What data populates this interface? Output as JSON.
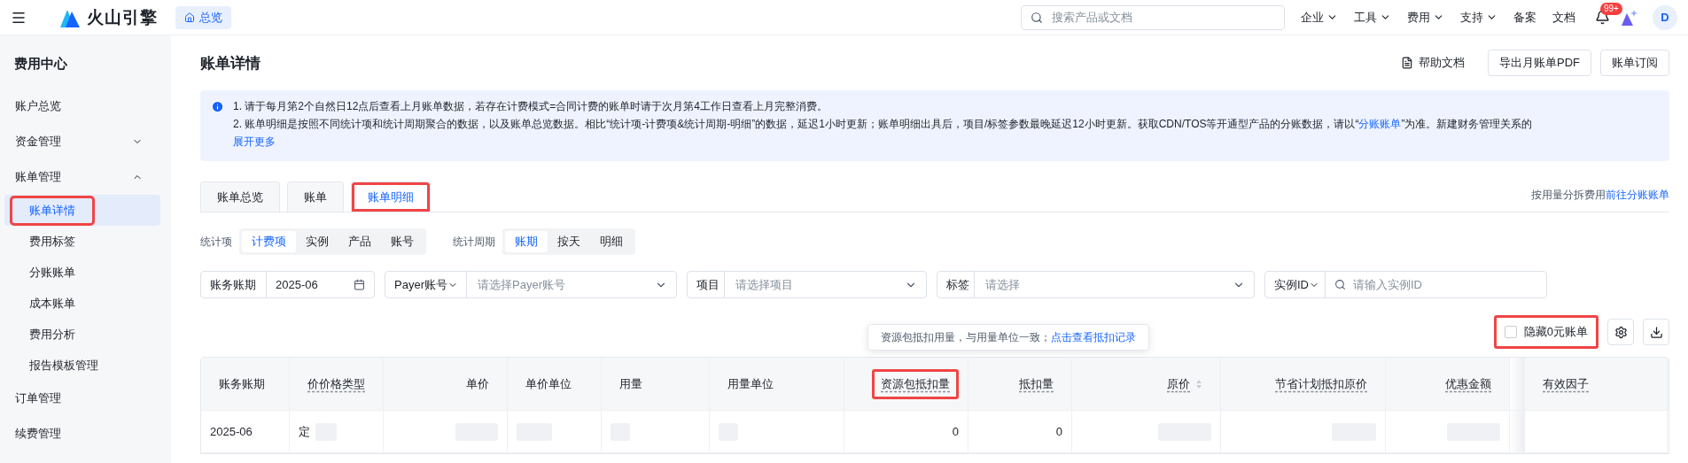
{
  "topbar": {
    "brand": "火山引擎",
    "home_tab": "总览",
    "search": {
      "placeholder": "搜索产品或文档"
    },
    "menus": [
      {
        "label": "企业",
        "dropdown": true
      },
      {
        "label": "工具",
        "dropdown": true
      },
      {
        "label": "费用",
        "dropdown": true
      },
      {
        "label": "支持",
        "dropdown": true
      },
      {
        "label": "备案",
        "dropdown": false
      },
      {
        "label": "文档",
        "dropdown": false
      }
    ],
    "notifications_badge": "99+",
    "avatar": "D"
  },
  "sidebar": {
    "title": "费用中心",
    "items": [
      {
        "label": "账户总览",
        "selected": false
      },
      {
        "label": "资金管理",
        "expanded": false,
        "selected": false
      },
      {
        "label": "账单管理",
        "expanded": true,
        "selected": false,
        "children": [
          {
            "label": "账单详情",
            "selected": true,
            "highlighted": true
          },
          {
            "label": "费用标签",
            "selected": false,
            "highlighted": false
          },
          {
            "label": "分账账单",
            "selected": false,
            "highlighted": false
          },
          {
            "label": "成本账单",
            "selected": false,
            "highlighted": false
          },
          {
            "label": "费用分析",
            "selected": false,
            "highlighted": false
          },
          {
            "label": "报告模板管理",
            "selected": false,
            "highlighted": false
          }
        ]
      },
      {
        "label": "订单管理",
        "selected": false
      },
      {
        "label": "续费管理",
        "selected": false
      }
    ]
  },
  "page": {
    "title": "账单详情",
    "help_link": "帮助文档",
    "buttons": [
      "导出月账单PDF",
      "账单订阅"
    ]
  },
  "notice": {
    "lines": [
      {
        "text": "1. 请于每月第2个自然日12点后查看上月账单数据，若存在计费模式=合同计费的账单时请于次月第4工作日查看上月完整消费。"
      },
      {
        "text": "2. 账单明细是按照不同统计项和统计周期聚合的数据，以及账单总览数据。相比“统计项-计费项&统计周期-明细”的数据，延迟1小时更新；账单明细出具后，项目/标签参数最晚延迟12小时更新。获取CDN/TOS等开通型产品的分账数据，请以“",
        "link": "分账账单",
        "after": "”为准。新建财务管理关系的"
      }
    ],
    "more_link": "展开更多"
  },
  "tabs": [
    {
      "label": "账单总览",
      "selected": false,
      "highlighted": false
    },
    {
      "label": "账单",
      "selected": false,
      "highlighted": false
    },
    {
      "label": "账单明细",
      "selected": true,
      "highlighted": true
    }
  ],
  "split_hint": {
    "text": "按用量分拆费用",
    "link": "前往分账账单"
  },
  "groupings": [
    {
      "label": "统计项",
      "options": [
        {
          "label": "计费项",
          "selected": true
        },
        {
          "label": "实例",
          "selected": false
        },
        {
          "label": "产品",
          "selected": false
        },
        {
          "label": "账号",
          "selected": false
        }
      ]
    },
    {
      "label": "统计周期",
      "options": [
        {
          "label": "账期",
          "selected": true
        },
        {
          "label": "按天",
          "selected": false
        },
        {
          "label": "明细",
          "selected": false
        }
      ]
    }
  ],
  "filters": [
    {
      "kind": "date",
      "label": "账务账期",
      "value": "2025-06"
    },
    {
      "kind": "select",
      "label": "Payer账号",
      "label_dropdown": true,
      "placeholder": "请选择Payer账号"
    },
    {
      "kind": "select",
      "label": "项目",
      "label_dropdown": false,
      "placeholder": "请选择项目"
    },
    {
      "kind": "select",
      "label": "标签",
      "label_dropdown": false,
      "placeholder": "请选择"
    },
    {
      "kind": "search",
      "label": "实例ID",
      "label_dropdown": true,
      "placeholder": "请输入实例ID"
    }
  ],
  "hide_zero": {
    "label": "隐藏0元账单",
    "checked": false,
    "highlighted": true
  },
  "tooltip": {
    "text": "资源包抵扣用量，与用量单位一致；",
    "link": "点击查看抵扣记录"
  },
  "table": {
    "columns": [
      {
        "label": "账务账期",
        "dotted": false,
        "sortable": false,
        "highlighted": false
      },
      {
        "label": "价价格类型",
        "dotted": true,
        "sortable": false,
        "highlighted": false
      },
      {
        "label": "单价",
        "dotted": false,
        "sortable": false,
        "highlighted": false
      },
      {
        "label": "单价单位",
        "dotted": false,
        "sortable": false,
        "highlighted": false
      },
      {
        "label": "用量",
        "dotted": false,
        "sortable": false,
        "highlighted": false
      },
      {
        "label": "用量单位",
        "dotted": false,
        "sortable": false,
        "highlighted": false
      },
      {
        "label": "资源包抵扣量",
        "dotted": true,
        "sortable": false,
        "highlighted": true
      },
      {
        "label": "抵扣量",
        "dotted": true,
        "sortable": false,
        "highlighted": false
      },
      {
        "label": "原价",
        "dotted": true,
        "sortable": true,
        "highlighted": false
      },
      {
        "label": "节省计划抵扣原价",
        "dotted": true,
        "sortable": false,
        "highlighted": false
      },
      {
        "label": "优惠金额",
        "dotted": true,
        "sortable": false,
        "highlighted": false
      },
      {
        "label": "有效因子",
        "dotted": true,
        "sortable": false,
        "highlighted": false
      }
    ],
    "rows": [
      [
        {
          "kind": "text",
          "text": "2025-06"
        },
        {
          "kind": "mixed",
          "text": "定"
        },
        {
          "kind": "blurred"
        },
        {
          "kind": "blurred"
        },
        {
          "kind": "blurred"
        },
        {
          "kind": "blurred"
        },
        {
          "kind": "text",
          "text": "0"
        },
        {
          "kind": "text",
          "text": "0"
        },
        {
          "kind": "blurred"
        },
        {
          "kind": "blurred"
        },
        {
          "kind": "blurred"
        },
        {
          "kind": "empty"
        }
      ]
    ]
  }
}
